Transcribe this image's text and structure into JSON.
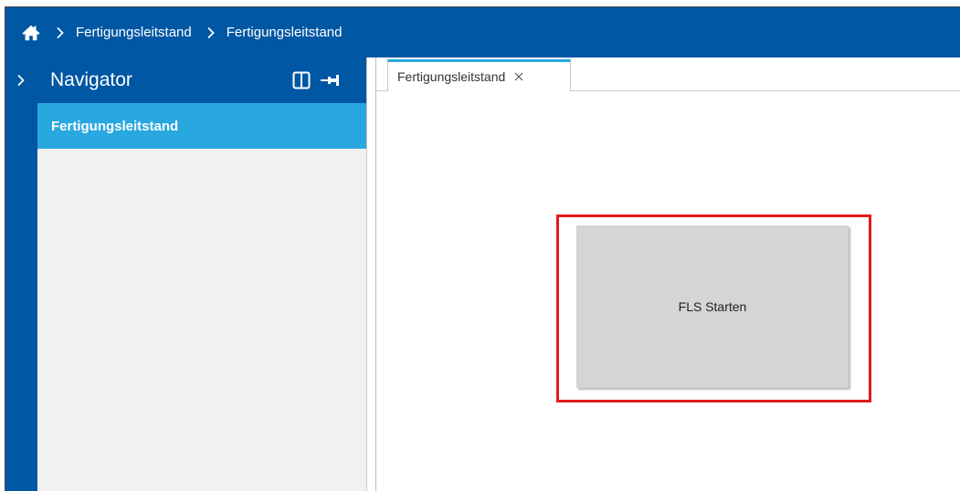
{
  "breadcrumb": {
    "items": [
      "Fertigungsleitstand",
      "Fertigungsleitstand"
    ]
  },
  "navigator": {
    "title": "Navigator",
    "items": [
      {
        "label": "Fertigungsleitstand",
        "selected": true
      }
    ]
  },
  "tabs": [
    {
      "label": "Fertigungsleitstand",
      "active": true
    }
  ],
  "main": {
    "start_button_label": "FLS Starten"
  },
  "colors": {
    "header_blue": "#0057a3",
    "accent_blue": "#29a8e0",
    "highlight_red": "#e01b1b",
    "button_gray": "#d5d5d8"
  },
  "icons": [
    "home-icon",
    "chevron-right-icon",
    "split-view-icon",
    "pin-icon",
    "close-icon"
  ]
}
